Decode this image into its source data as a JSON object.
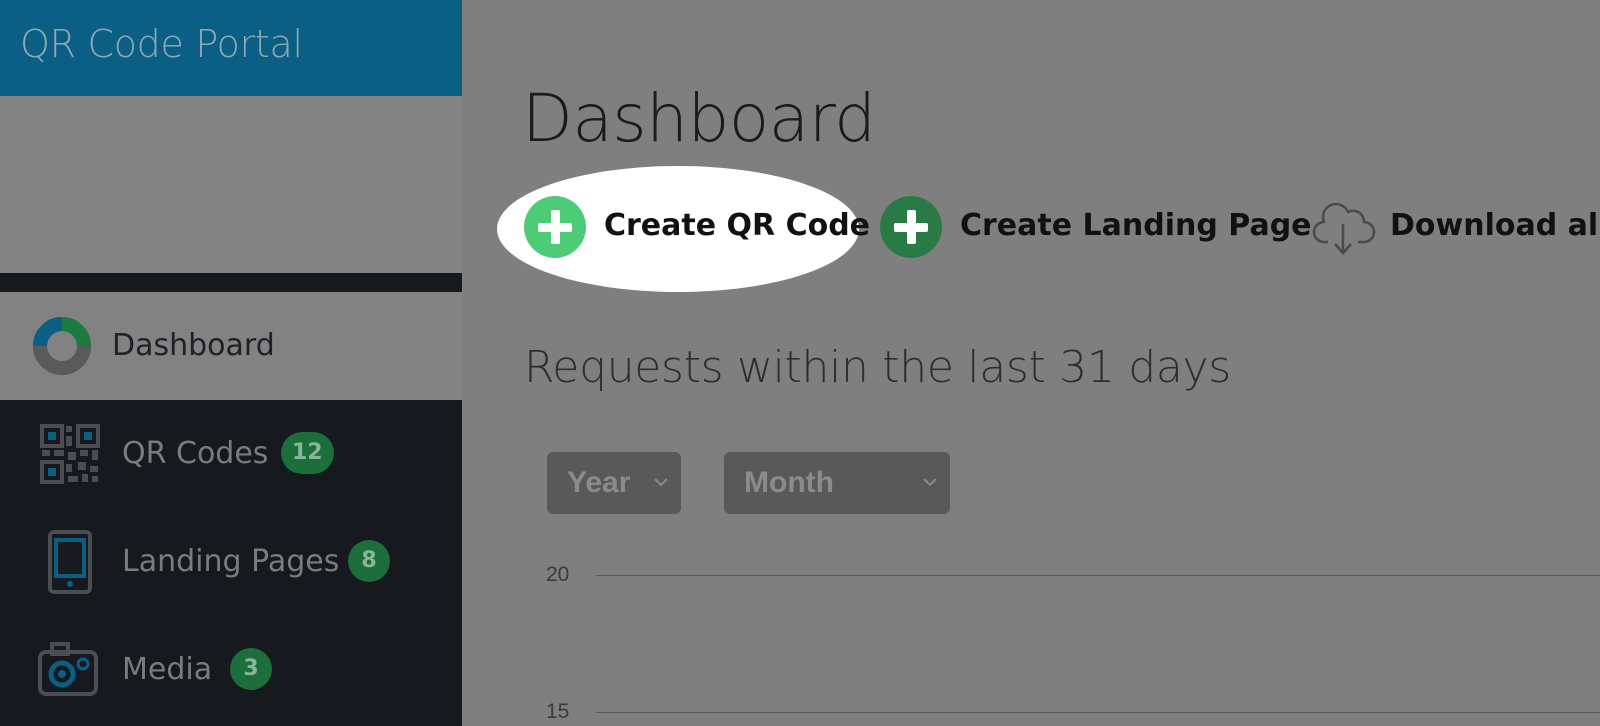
{
  "app": {
    "title": "QR Code Portal"
  },
  "sidebar": {
    "items": [
      {
        "label": "Dashboard",
        "icon": "donut-chart-icon",
        "active": true
      },
      {
        "label": "QR Codes",
        "icon": "qr-code-icon",
        "badge": "12"
      },
      {
        "label": "Landing Pages",
        "icon": "tablet-icon",
        "badge": "8"
      },
      {
        "label": "Media",
        "icon": "camera-icon",
        "badge": "3"
      }
    ]
  },
  "main": {
    "title": "Dashboard",
    "actions": [
      {
        "label": "Create QR Code",
        "icon": "plus-circle-icon",
        "color": "#4ecb76",
        "highlighted": true
      },
      {
        "label": "Create Landing Page",
        "icon": "plus-circle-icon",
        "color": "#2a7a45"
      },
      {
        "label": "Download all",
        "icon": "cloud-download-icon"
      }
    ],
    "subtitle": "Requests within the last 31 days",
    "filters": {
      "year": {
        "selected": "Year"
      },
      "month": {
        "selected": "Month"
      }
    },
    "chart": {
      "y_ticks": [
        "20",
        "15"
      ]
    }
  },
  "colors": {
    "brand": "#0b5f85",
    "sidebar_bg": "#16191d",
    "badge": "#1c6e3a",
    "overlay": "#7f7f7f"
  }
}
